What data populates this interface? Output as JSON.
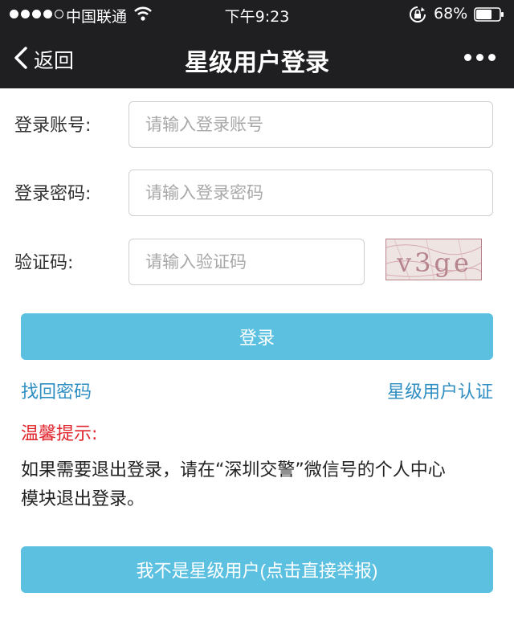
{
  "status_bar": {
    "carrier": "中国联通",
    "time": "下午9:23",
    "battery": "68%",
    "battery_level": 0.68,
    "signal_bars": 4,
    "icons": [
      "wifi-icon",
      "rotation-lock-icon",
      "battery-icon"
    ]
  },
  "navbar": {
    "back_label": "返回",
    "title": "星级用户登录",
    "icons": [
      "chevron-left-icon",
      "more-icon"
    ]
  },
  "form": {
    "account": {
      "label": "登录账号:",
      "placeholder": "请输入登录账号",
      "value": ""
    },
    "password": {
      "label": "登录密码:",
      "placeholder": "请输入登录密码",
      "value": ""
    },
    "captcha": {
      "label": "验证码:",
      "placeholder": "请输入验证码",
      "value": "",
      "image_text": "v3ge"
    },
    "login_button": "登录"
  },
  "links": {
    "recover_password": "找回密码",
    "star_user_auth": "星级用户认证"
  },
  "tip": {
    "title": "温馨提示:",
    "line1": "如果需要退出登录，请在“深圳交警”微信号的个人中心",
    "line2": "模块退出登录。"
  },
  "report_button": "我不是星级用户(点击直接举报)",
  "colors": {
    "header_bg": "#1f1f21",
    "button": "#5cc0e0",
    "link": "#2f8ec2",
    "tip_title": "#e0222a"
  }
}
